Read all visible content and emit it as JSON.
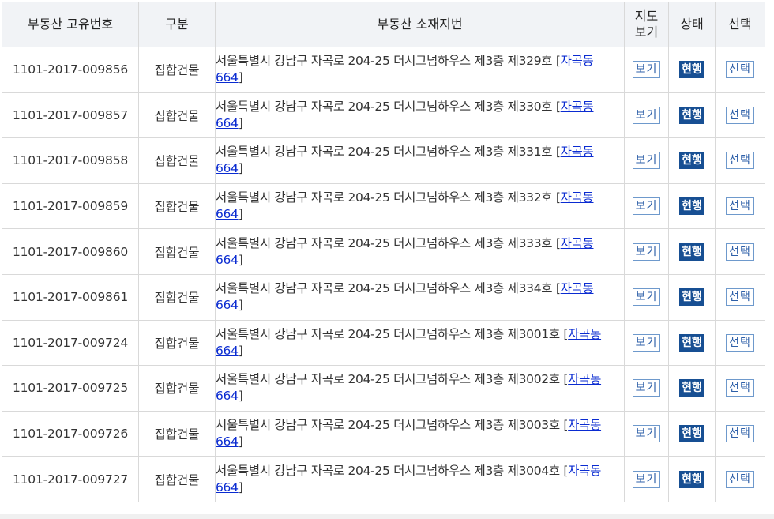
{
  "headers": {
    "uid": "부동산 고유번호",
    "kind": "구분",
    "address": "부동산 소재지번",
    "map_line1": "지도",
    "map_line2": "보기",
    "status": "상태",
    "select": "선택"
  },
  "labels": {
    "map_button": "보기",
    "status_badge": "현행",
    "select_button": "선택"
  },
  "rows": [
    {
      "uid": "1101-2017-009856",
      "kind": "집합건물",
      "address": "서울특별시 강남구 자곡로 204-25 더시그넘하우스 제3층 제329호",
      "dong": "자곡동",
      "jibun": "664"
    },
    {
      "uid": "1101-2017-009857",
      "kind": "집합건물",
      "address": "서울특별시 강남구 자곡로 204-25 더시그넘하우스 제3층 제330호",
      "dong": "자곡동",
      "jibun": "664"
    },
    {
      "uid": "1101-2017-009858",
      "kind": "집합건물",
      "address": "서울특별시 강남구 자곡로 204-25 더시그넘하우스 제3층 제331호",
      "dong": "자곡동",
      "jibun": "664"
    },
    {
      "uid": "1101-2017-009859",
      "kind": "집합건물",
      "address": "서울특별시 강남구 자곡로 204-25 더시그넘하우스 제3층 제332호",
      "dong": "자곡동",
      "jibun": "664"
    },
    {
      "uid": "1101-2017-009860",
      "kind": "집합건물",
      "address": "서울특별시 강남구 자곡로 204-25 더시그넘하우스 제3층 제333호",
      "dong": "자곡동",
      "jibun": "664"
    },
    {
      "uid": "1101-2017-009861",
      "kind": "집합건물",
      "address": "서울특별시 강남구 자곡로 204-25 더시그넘하우스 제3층 제334호",
      "dong": "자곡동",
      "jibun": "664"
    },
    {
      "uid": "1101-2017-009724",
      "kind": "집합건물",
      "address": "서울특별시 강남구 자곡로 204-25 더시그넘하우스 제3층 제3001호",
      "dong": "자곡동",
      "jibun": "664"
    },
    {
      "uid": "1101-2017-009725",
      "kind": "집합건물",
      "address": "서울특별시 강남구 자곡로 204-25 더시그넘하우스 제3층 제3002호",
      "dong": "자곡동",
      "jibun": "664"
    },
    {
      "uid": "1101-2017-009726",
      "kind": "집합건물",
      "address": "서울특별시 강남구 자곡로 204-25 더시그넘하우스 제3층 제3003호",
      "dong": "자곡동",
      "jibun": "664"
    },
    {
      "uid": "1101-2017-009727",
      "kind": "집합건물",
      "address": "서울특별시 강남구 자곡로 204-25 더시그넘하우스 제3층 제3004호",
      "dong": "자곡동",
      "jibun": "664"
    }
  ]
}
